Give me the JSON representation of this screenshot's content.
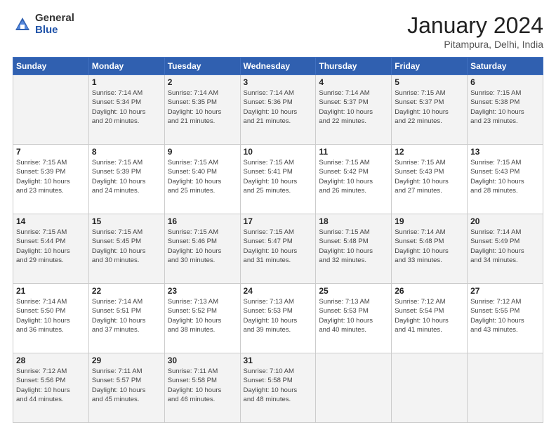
{
  "logo": {
    "general": "General",
    "blue": "Blue",
    "icon": "▶"
  },
  "header": {
    "month": "January 2024",
    "location": "Pitampura, Delhi, India"
  },
  "weekdays": [
    "Sunday",
    "Monday",
    "Tuesday",
    "Wednesday",
    "Thursday",
    "Friday",
    "Saturday"
  ],
  "weeks": [
    [
      {
        "day": "",
        "info": ""
      },
      {
        "day": "1",
        "info": "Sunrise: 7:14 AM\nSunset: 5:34 PM\nDaylight: 10 hours\nand 20 minutes."
      },
      {
        "day": "2",
        "info": "Sunrise: 7:14 AM\nSunset: 5:35 PM\nDaylight: 10 hours\nand 21 minutes."
      },
      {
        "day": "3",
        "info": "Sunrise: 7:14 AM\nSunset: 5:36 PM\nDaylight: 10 hours\nand 21 minutes."
      },
      {
        "day": "4",
        "info": "Sunrise: 7:14 AM\nSunset: 5:37 PM\nDaylight: 10 hours\nand 22 minutes."
      },
      {
        "day": "5",
        "info": "Sunrise: 7:15 AM\nSunset: 5:37 PM\nDaylight: 10 hours\nand 22 minutes."
      },
      {
        "day": "6",
        "info": "Sunrise: 7:15 AM\nSunset: 5:38 PM\nDaylight: 10 hours\nand 23 minutes."
      }
    ],
    [
      {
        "day": "7",
        "info": "Sunrise: 7:15 AM\nSunset: 5:39 PM\nDaylight: 10 hours\nand 23 minutes."
      },
      {
        "day": "8",
        "info": "Sunrise: 7:15 AM\nSunset: 5:39 PM\nDaylight: 10 hours\nand 24 minutes."
      },
      {
        "day": "9",
        "info": "Sunrise: 7:15 AM\nSunset: 5:40 PM\nDaylight: 10 hours\nand 25 minutes."
      },
      {
        "day": "10",
        "info": "Sunrise: 7:15 AM\nSunset: 5:41 PM\nDaylight: 10 hours\nand 25 minutes."
      },
      {
        "day": "11",
        "info": "Sunrise: 7:15 AM\nSunset: 5:42 PM\nDaylight: 10 hours\nand 26 minutes."
      },
      {
        "day": "12",
        "info": "Sunrise: 7:15 AM\nSunset: 5:43 PM\nDaylight: 10 hours\nand 27 minutes."
      },
      {
        "day": "13",
        "info": "Sunrise: 7:15 AM\nSunset: 5:43 PM\nDaylight: 10 hours\nand 28 minutes."
      }
    ],
    [
      {
        "day": "14",
        "info": "Sunrise: 7:15 AM\nSunset: 5:44 PM\nDaylight: 10 hours\nand 29 minutes."
      },
      {
        "day": "15",
        "info": "Sunrise: 7:15 AM\nSunset: 5:45 PM\nDaylight: 10 hours\nand 30 minutes."
      },
      {
        "day": "16",
        "info": "Sunrise: 7:15 AM\nSunset: 5:46 PM\nDaylight: 10 hours\nand 30 minutes."
      },
      {
        "day": "17",
        "info": "Sunrise: 7:15 AM\nSunset: 5:47 PM\nDaylight: 10 hours\nand 31 minutes."
      },
      {
        "day": "18",
        "info": "Sunrise: 7:15 AM\nSunset: 5:48 PM\nDaylight: 10 hours\nand 32 minutes."
      },
      {
        "day": "19",
        "info": "Sunrise: 7:14 AM\nSunset: 5:48 PM\nDaylight: 10 hours\nand 33 minutes."
      },
      {
        "day": "20",
        "info": "Sunrise: 7:14 AM\nSunset: 5:49 PM\nDaylight: 10 hours\nand 34 minutes."
      }
    ],
    [
      {
        "day": "21",
        "info": "Sunrise: 7:14 AM\nSunset: 5:50 PM\nDaylight: 10 hours\nand 36 minutes."
      },
      {
        "day": "22",
        "info": "Sunrise: 7:14 AM\nSunset: 5:51 PM\nDaylight: 10 hours\nand 37 minutes."
      },
      {
        "day": "23",
        "info": "Sunrise: 7:13 AM\nSunset: 5:52 PM\nDaylight: 10 hours\nand 38 minutes."
      },
      {
        "day": "24",
        "info": "Sunrise: 7:13 AM\nSunset: 5:53 PM\nDaylight: 10 hours\nand 39 minutes."
      },
      {
        "day": "25",
        "info": "Sunrise: 7:13 AM\nSunset: 5:53 PM\nDaylight: 10 hours\nand 40 minutes."
      },
      {
        "day": "26",
        "info": "Sunrise: 7:12 AM\nSunset: 5:54 PM\nDaylight: 10 hours\nand 41 minutes."
      },
      {
        "day": "27",
        "info": "Sunrise: 7:12 AM\nSunset: 5:55 PM\nDaylight: 10 hours\nand 43 minutes."
      }
    ],
    [
      {
        "day": "28",
        "info": "Sunrise: 7:12 AM\nSunset: 5:56 PM\nDaylight: 10 hours\nand 44 minutes."
      },
      {
        "day": "29",
        "info": "Sunrise: 7:11 AM\nSunset: 5:57 PM\nDaylight: 10 hours\nand 45 minutes."
      },
      {
        "day": "30",
        "info": "Sunrise: 7:11 AM\nSunset: 5:58 PM\nDaylight: 10 hours\nand 46 minutes."
      },
      {
        "day": "31",
        "info": "Sunrise: 7:10 AM\nSunset: 5:58 PM\nDaylight: 10 hours\nand 48 minutes."
      },
      {
        "day": "",
        "info": ""
      },
      {
        "day": "",
        "info": ""
      },
      {
        "day": "",
        "info": ""
      }
    ]
  ]
}
